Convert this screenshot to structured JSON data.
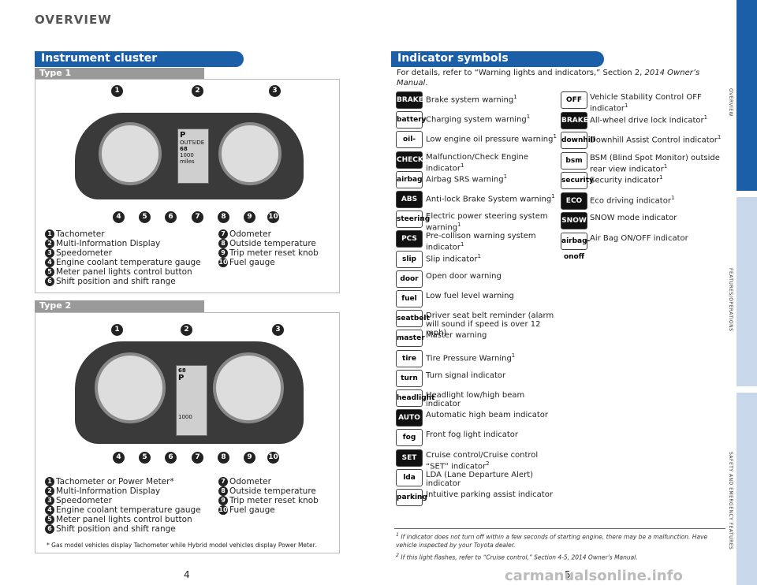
{
  "header": {
    "title": "OVERVIEW"
  },
  "left": {
    "section_title": "Instrument cluster",
    "type1": {
      "label": "Type 1",
      "legend_left": [
        "Tachometer",
        "Multi-Information Display",
        "Speedometer",
        "Engine coolant temperature gauge",
        "Meter panel lights control button",
        "Shift position and shift range"
      ],
      "legend_right": [
        "Odometer",
        "Outside temperature",
        "Trip meter reset knob",
        "Fuel gauge"
      ],
      "display_lines": [
        "P",
        "OUTSIDE",
        "68",
        "1000",
        "miles"
      ]
    },
    "type2": {
      "label": "Type 2",
      "legend_left": [
        "Tachometer or Power Meter*",
        "Multi-Information Display",
        "Speedometer",
        "Engine coolant temperature gauge",
        "Meter panel lights control button",
        "Shift position and shift range"
      ],
      "legend_right": [
        "Odometer",
        "Outside temperature",
        "Trip meter reset knob",
        "Fuel gauge"
      ],
      "footnote": "* Gas model vehicles display Tachometer while Hybrid model vehicles display Power Meter.",
      "display_lines": [
        "68",
        "P",
        "1000"
      ]
    },
    "numbers": [
      "1",
      "2",
      "3",
      "4",
      "5",
      "6",
      "7",
      "8",
      "9",
      "10"
    ],
    "page": "4"
  },
  "right": {
    "section_title": "Indicator symbols",
    "intro": "For details, refer to “Warning lights and indicators,” Section 2,",
    "intro_italic": "2014 Owner’s Manual",
    "indicators_left": [
      {
        "icon": "BRAKE",
        "label": "Brake system warning",
        "sup": "1"
      },
      {
        "icon": "battery",
        "label": "Charging system warning",
        "sup": "1"
      },
      {
        "icon": "oil-can",
        "label": "Low engine oil pressure warning",
        "sup": "1"
      },
      {
        "icon": "CHECK",
        "label": "Malfunction/Check Engine indicator",
        "sup": "1"
      },
      {
        "icon": "airbag",
        "label": "Airbag SRS warning",
        "sup": "1"
      },
      {
        "icon": "ABS",
        "label": "Anti-lock Brake System warning",
        "sup": "1"
      },
      {
        "icon": "steering",
        "label": "Electric power steering system warning",
        "sup": "1"
      },
      {
        "icon": "PCS",
        "label": "Pre-collison warning system indicator",
        "sup": "1"
      },
      {
        "icon": "slip",
        "label": "Slip indicator",
        "sup": "1"
      },
      {
        "icon": "door",
        "label": "Open door warning",
        "sup": ""
      },
      {
        "icon": "fuel",
        "label": "Low fuel level warning",
        "sup": ""
      },
      {
        "icon": "seatbelt",
        "label": "Driver seat belt reminder (alarm will sound if speed is over 12 mph)",
        "sup": ""
      },
      {
        "icon": "master",
        "label": "Master warning",
        "sup": ""
      },
      {
        "icon": "tire",
        "label": "Tire Pressure Warning",
        "sup": "1"
      },
      {
        "icon": "turn",
        "label": "Turn signal indicator",
        "sup": ""
      },
      {
        "icon": "headlight",
        "label": "Headlight low/high beam indicator",
        "sup": ""
      },
      {
        "icon": "AUTO",
        "label": "Automatic high beam indicator",
        "sup": ""
      },
      {
        "icon": "fog",
        "label": "Front fog light indicator",
        "sup": ""
      },
      {
        "icon": "SET",
        "label": "Cruise control/Cruise control “SET” indicator",
        "sup": "2"
      },
      {
        "icon": "lda",
        "label": "LDA (Lane Departure Alert) indicator",
        "sup": ""
      },
      {
        "icon": "parking",
        "label": "Intuitive parking assist indicator",
        "sup": ""
      }
    ],
    "indicators_right": [
      {
        "icon": "OFF",
        "label": "Vehicle Stability Control OFF indicator",
        "sup": "1"
      },
      {
        "icon": "BRAKE",
        "label": "All-wheel drive lock indicator",
        "sup": "1"
      },
      {
        "icon": "downhill",
        "label": "Downhill Assist Control indicator",
        "sup": "1"
      },
      {
        "icon": "bsm",
        "label": "BSM (Blind Spot Monitor) outside rear view indicator",
        "sup": "1"
      },
      {
        "icon": "security",
        "label": "Security indicator",
        "sup": "1"
      },
      {
        "icon": "ECO",
        "label": "Eco driving indicator",
        "sup": "1"
      },
      {
        "icon": "SNOW",
        "label": "SNOW mode indicator",
        "sup": ""
      },
      {
        "icon": "airbag-onoff",
        "label": "Air Bag ON/OFF indicator",
        "sup": ""
      }
    ],
    "footnotes": [
      "If indicator does not turn off within a few seconds of starting engine, there may be a malfunction. Have vehicle inspected by your Toyota dealer.",
      "If this light flashes, refer to “Cruise control,” Section 4-5, 2014 Owner’s Manual."
    ],
    "page": "5"
  },
  "side_tabs": [
    "OVERVIEW",
    "FEATURES/OPERATIONS",
    "SAFETY AND EMERGENCY FEATURES"
  ],
  "watermark": "carmanualsonline.info"
}
